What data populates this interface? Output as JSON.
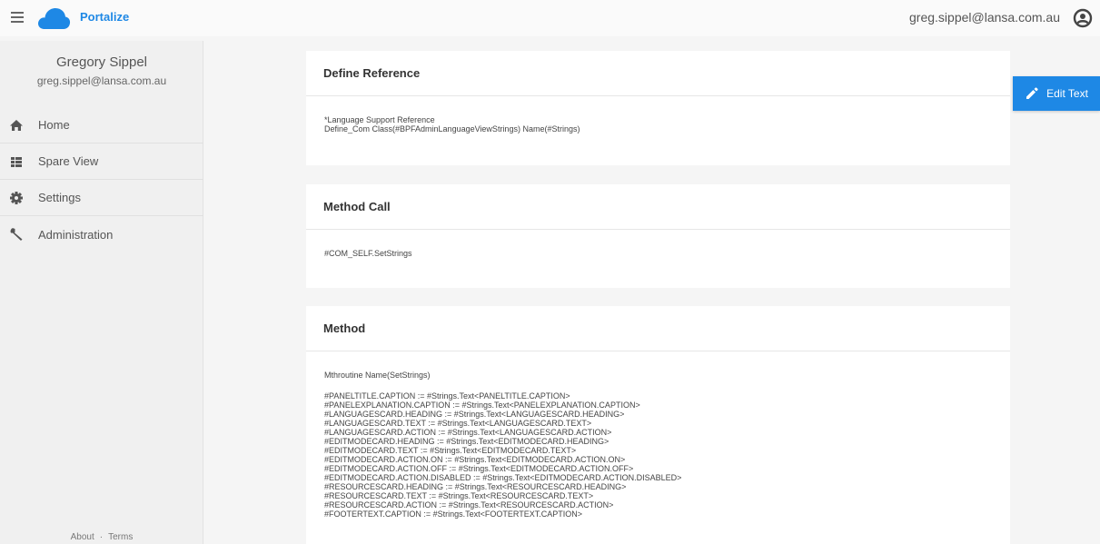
{
  "app": {
    "title": "Portalize"
  },
  "header": {
    "user_email": "greg.sippel@lansa.com.au"
  },
  "sidebar": {
    "profile_name": "Gregory Sippel",
    "profile_email": "greg.sippel@lansa.com.au",
    "items": [
      {
        "label": "Home",
        "icon": "home-icon"
      },
      {
        "label": "Spare View",
        "icon": "view-list-icon"
      },
      {
        "label": "Settings",
        "icon": "gear-icon"
      },
      {
        "label": "Administration",
        "icon": "wrench-icon"
      }
    ],
    "footer": {
      "about": "About",
      "separator": "·",
      "terms": "Terms"
    }
  },
  "edit_button": {
    "label": "Edit Text",
    "icon": "pencil-icon"
  },
  "cards": {
    "define_reference": {
      "title": "Define Reference",
      "lines": [
        "*Language Support Reference",
        "Define_Com Class(#BPFAdminLanguageViewStrings) Name(#Strings)"
      ]
    },
    "method_call": {
      "title": "Method Call",
      "lines": [
        "#COM_SELF.SetStrings"
      ]
    },
    "method": {
      "title": "Method",
      "first_line": "Mthroutine Name(SetStrings)",
      "lines": [
        "#PANELTITLE.CAPTION := #Strings.Text<PANELTITLE.CAPTION>",
        "#PANELEXPLANATION.CAPTION := #Strings.Text<PANELEXPLANATION.CAPTION>",
        "#LANGUAGESCARD.HEADING := #Strings.Text<LANGUAGESCARD.HEADING>",
        "#LANGUAGESCARD.TEXT := #Strings.Text<LANGUAGESCARD.TEXT>",
        "#LANGUAGESCARD.ACTION := #Strings.Text<LANGUAGESCARD.ACTION>",
        "#EDITMODECARD.HEADING := #Strings.Text<EDITMODECARD.HEADING>",
        "#EDITMODECARD.TEXT := #Strings.Text<EDITMODECARD.TEXT>",
        "#EDITMODECARD.ACTION.ON := #Strings.Text<EDITMODECARD.ACTION.ON>",
        "#EDITMODECARD.ACTION.OFF := #Strings.Text<EDITMODECARD.ACTION.OFF>",
        "#EDITMODECARD.ACTION.DISABLED := #Strings.Text<EDITMODECARD.ACTION.DISABLED>",
        "#RESOURCESCARD.HEADING := #Strings.Text<RESOURCESCARD.HEADING>",
        "#RESOURCESCARD.TEXT := #Strings.Text<RESOURCESCARD.TEXT>",
        "#RESOURCESCARD.ACTION := #Strings.Text<RESOURCESCARD.ACTION>",
        "#FOOTERTEXT.CAPTION := #Strings.Text<FOOTERTEXT.CAPTION>"
      ]
    }
  },
  "colors": {
    "accent": "#1e88e5",
    "background": "#f5f5f5",
    "card": "#ffffff"
  }
}
